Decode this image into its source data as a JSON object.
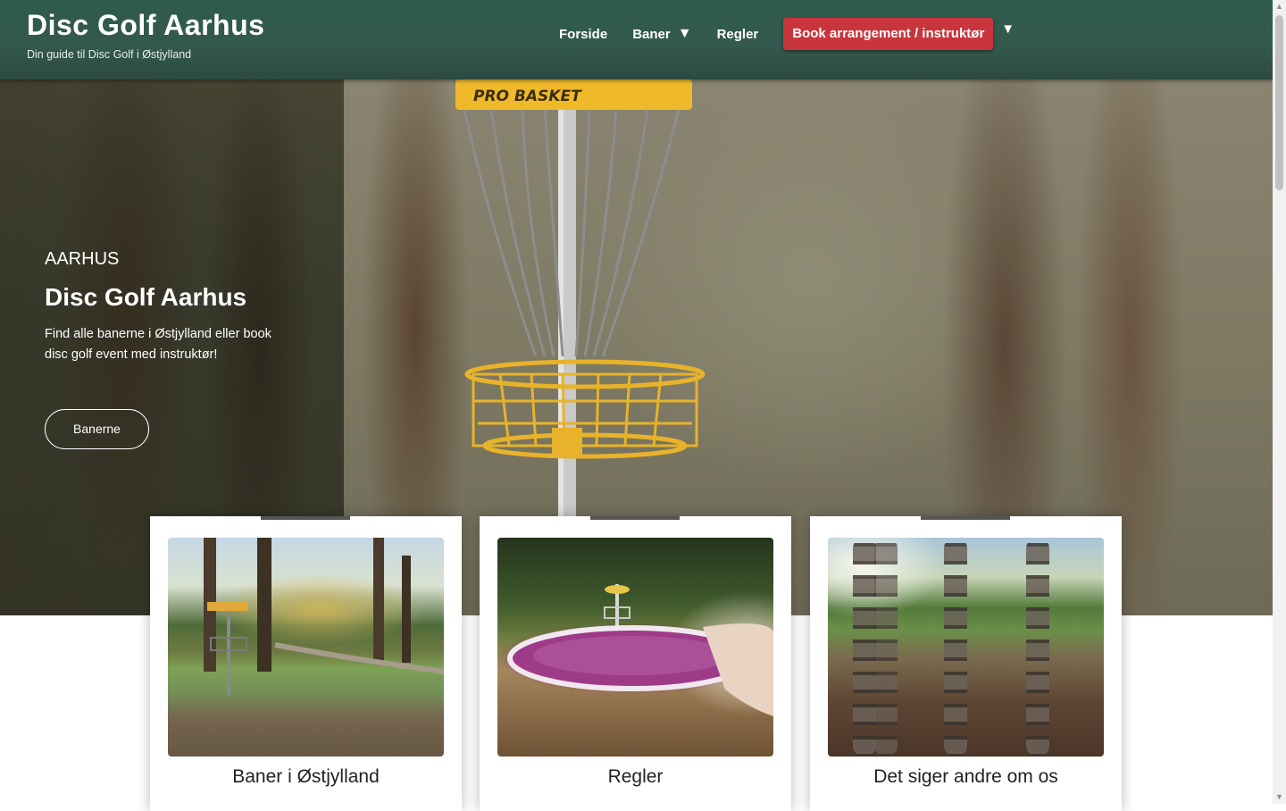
{
  "header": {
    "site_title": "Disc Golf Aarhus",
    "tagline": "Din guide til Disc Golf i Østjylland",
    "nav": [
      {
        "label": "Forside",
        "has_dropdown": false
      },
      {
        "label": "Baner",
        "has_dropdown": true
      },
      {
        "label": "Regler",
        "has_dropdown": false
      }
    ],
    "dropdown_arrow": "▼",
    "cta_label": "Book arrangement / instruktør",
    "cta_color": "#c9353c",
    "header_color": "#2e5a4e"
  },
  "hero": {
    "kicker": "AARHUS",
    "title": "Disc Golf Aarhus",
    "text": "Find alle banerne i Østjylland eller book disc golf event med instruktør!",
    "button_label": "Banerne",
    "image_label": "PRO BASKET"
  },
  "cards": [
    {
      "title": "Baner i Østjylland",
      "image": "basket-by-lake-photo"
    },
    {
      "title": "Regler",
      "image": "hand-holding-disc-photo"
    },
    {
      "title": "Det siger andre om os",
      "image": "basket-chains-closeup-photo"
    }
  ],
  "scrollbar": {
    "up_icon": "▲",
    "down_icon": "▼"
  }
}
